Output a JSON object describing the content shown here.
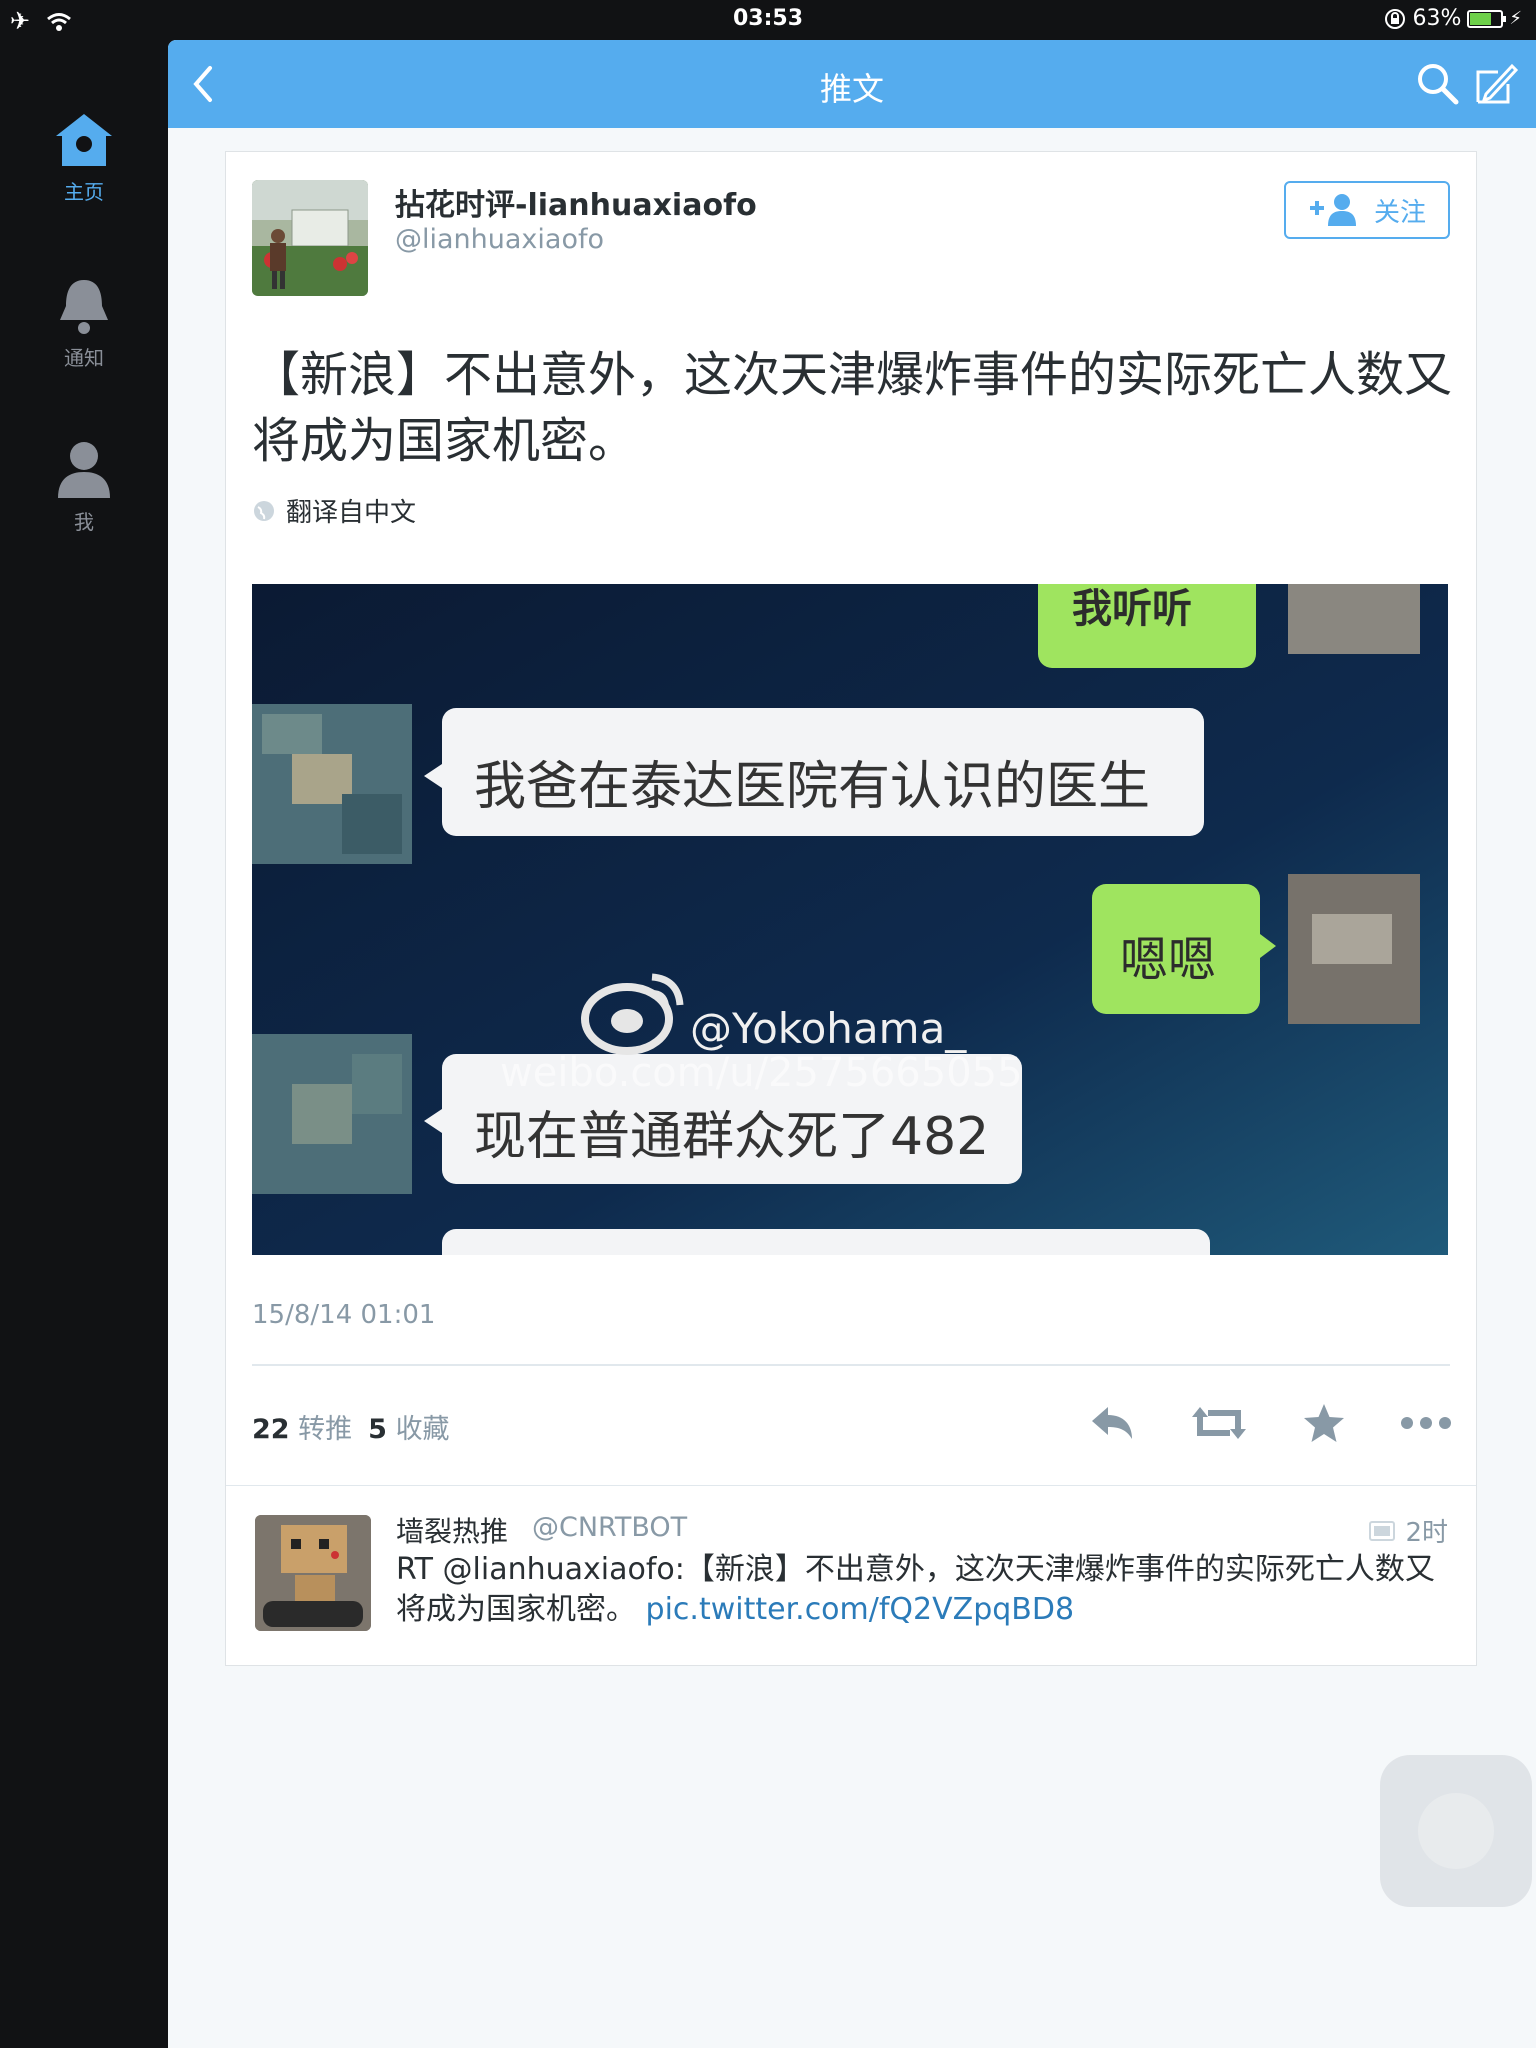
{
  "status_bar": {
    "time": "03:53",
    "battery_percent": "63%",
    "battery_level": 0.63
  },
  "sidebar": {
    "items": [
      {
        "label": "主页",
        "icon": "home-icon",
        "active": true
      },
      {
        "label": "通知",
        "icon": "bell-icon",
        "active": false
      },
      {
        "label": "我",
        "icon": "person-icon",
        "active": false
      }
    ]
  },
  "navbar": {
    "title": "推文"
  },
  "tweet": {
    "author_name": "拈花时评-lianhuaxiaofo",
    "author_handle": "@lianhuaxiaofo",
    "follow_label": "关注",
    "text": "【新浪】不出意外，这次天津爆炸事件的实际死亡人数又将成为国家机密。",
    "translate_label": "翻译自中文",
    "image": {
      "bubble_top": "我听听",
      "bubble_1": "我爸在泰达医院有认识的医生",
      "bubble_2": "嗯嗯",
      "bubble_3": "现在普通群众死了482",
      "watermark_handle": "@Yokohama_",
      "watermark_url": "weibo.com/u/2575665055"
    },
    "timestamp": "15/8/14 01:01",
    "retweet_count": "22",
    "retweet_label": "转推",
    "favorite_count": "5",
    "favorite_label": "收藏"
  },
  "reply": {
    "name": "墙裂热推",
    "handle": "@CNRTBOT",
    "time": "2时",
    "text": "RT @lianhuaxiaofo:【新浪】不出意外，这次天津爆炸事件的实际死亡人数又将成为国家机密。",
    "link": "pic.twitter.com/fQ2VZpqBD8"
  },
  "colors": {
    "accent": "#55acee",
    "sidebar_bg": "#111214",
    "link": "#2b7bb9"
  }
}
